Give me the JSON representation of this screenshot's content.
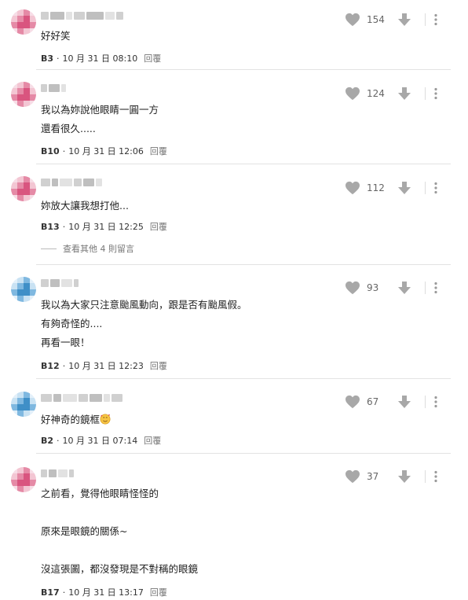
{
  "comments": [
    {
      "body": "好好笑",
      "floor": "B3",
      "date": "10 月 31 日 08:10",
      "reply": "回覆",
      "likes": "154",
      "tone": "pink"
    },
    {
      "body": "我以為妳說他眼睛一圓一方\n還看很久.....",
      "floor": "B10",
      "date": "10 月 31 日 12:06",
      "reply": "回覆",
      "likes": "124",
      "tone": "pink"
    },
    {
      "body": "妳放大讓我想打他...",
      "floor": "B13",
      "date": "10 月 31 日 12:25",
      "reply": "回覆",
      "likes": "112",
      "tone": "pink",
      "more_replies": "查看其他 4 則留言"
    },
    {
      "body": "我以為大家只注意颱風動向，跟是否有颱風假。\n有夠奇怪的....\n再看一眼！",
      "floor": "B12",
      "date": "10 月 31 日 12:23",
      "reply": "回覆",
      "likes": "93",
      "tone": "blue"
    },
    {
      "body": "好神奇的鏡框",
      "floor": "B2",
      "date": "10 月 31 日 07:14",
      "reply": "回覆",
      "likes": "67",
      "tone": "blue",
      "emoji": "smiling-face-with-hearts"
    },
    {
      "body": "之前看，覺得他眼睛怪怪的\n\n原來是眼鏡的關係~\n\n沒這張圖，都沒發現是不對稱的眼鏡",
      "floor": "B17",
      "date": "10 月 31 日 13:17",
      "reply": "回覆",
      "likes": "37",
      "tone": "pink"
    }
  ],
  "colors": {
    "pink": [
      "#f3c6d3",
      "#e58aa6",
      "#d9557f",
      "#f7dde6"
    ],
    "blue": [
      "#c9e2f3",
      "#7fb8e0",
      "#3f8fc7",
      "#e3f0fa"
    ],
    "icon": "#a8a8a8"
  }
}
